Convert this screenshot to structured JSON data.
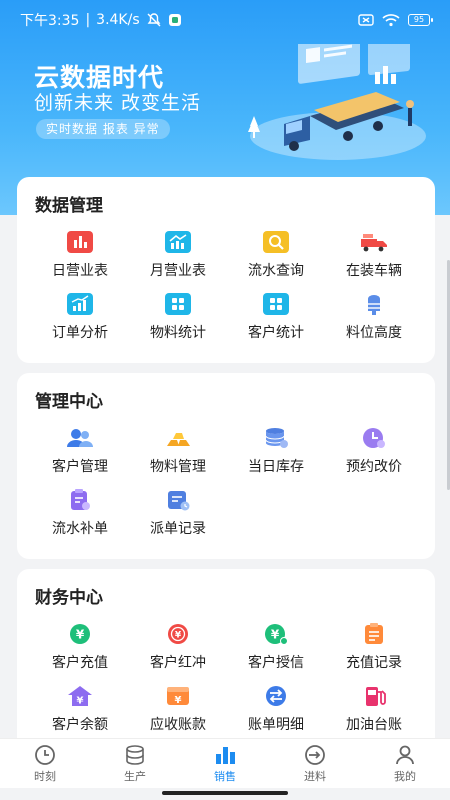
{
  "status_bar": {
    "time": "下午3:35",
    "speed": "3.4K/s",
    "battery": "95"
  },
  "banner": {
    "title": "云数据时代",
    "subtitle": "创新未来  改变生活",
    "tag": "实时数据  报表  异常"
  },
  "sections": [
    {
      "title": "数据管理",
      "items": [
        {
          "label": "日营业表",
          "icon": "bar-chart-icon"
        },
        {
          "label": "月营业表",
          "icon": "trend-chart-icon"
        },
        {
          "label": "流水查询",
          "icon": "search-icon"
        },
        {
          "label": "在装车辆",
          "icon": "truck-icon"
        },
        {
          "label": "订单分析",
          "icon": "order-analysis-icon"
        },
        {
          "label": "物料统计",
          "icon": "grid-icon"
        },
        {
          "label": "客户统计",
          "icon": "customer-grid-icon"
        },
        {
          "label": "料位高度",
          "icon": "silo-icon"
        }
      ]
    },
    {
      "title": "管理中心",
      "items": [
        {
          "label": "客户管理",
          "icon": "users-icon"
        },
        {
          "label": "物料管理",
          "icon": "gold-bars-icon"
        },
        {
          "label": "当日库存",
          "icon": "database-icon"
        },
        {
          "label": "预约改价",
          "icon": "clock-icon"
        },
        {
          "label": "流水补单",
          "icon": "clipboard-add-icon"
        },
        {
          "label": "派单记录",
          "icon": "dispatch-record-icon"
        }
      ]
    },
    {
      "title": "财务中心",
      "items": [
        {
          "label": "客户充值",
          "icon": "yuan-recharge-icon"
        },
        {
          "label": "客户红冲",
          "icon": "yuan-reverse-icon"
        },
        {
          "label": "客户授信",
          "icon": "yuan-credit-icon"
        },
        {
          "label": "充值记录",
          "icon": "recharge-record-icon"
        },
        {
          "label": "客户余额",
          "icon": "yuan-house-icon"
        },
        {
          "label": "应收账款",
          "icon": "receivable-icon"
        },
        {
          "label": "账单明细",
          "icon": "exchange-icon"
        },
        {
          "label": "加油台账",
          "icon": "fuel-icon"
        }
      ]
    }
  ],
  "tabbar": [
    {
      "label": "时刻",
      "icon": "clock-tab-icon",
      "active": false
    },
    {
      "label": "生产",
      "icon": "database-tab-icon",
      "active": false
    },
    {
      "label": "销售",
      "icon": "bar-chart-tab-icon",
      "active": true
    },
    {
      "label": "进料",
      "icon": "import-tab-icon",
      "active": false
    },
    {
      "label": "我的",
      "icon": "user-tab-icon",
      "active": false
    }
  ],
  "colors": {
    "accent": "#1d8cf0",
    "red": "#f04a45",
    "cyan": "#1fb6e8",
    "yellow": "#f5bf26",
    "green": "#1ebf7a",
    "orange": "#ff8a3a",
    "purple": "#8d6cf0"
  }
}
